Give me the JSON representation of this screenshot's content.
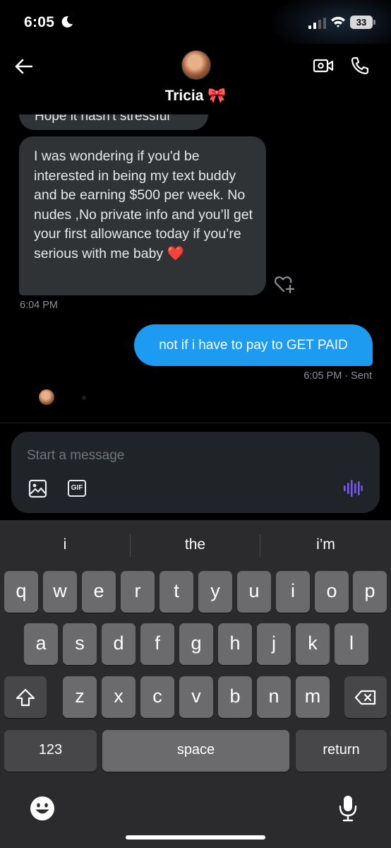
{
  "status_bar": {
    "time": "6:05",
    "battery": "33",
    "icons": [
      "moon-icon",
      "signal-icon",
      "wifi-icon",
      "battery-icon"
    ]
  },
  "header": {
    "contact_name": "Tricia 🎀",
    "icons": [
      "back-arrow-icon",
      "video-call-icon",
      "phone-call-icon"
    ]
  },
  "messages": {
    "partial_text": "Hope it hasn't stressful",
    "incoming": {
      "text": "I was wondering if you'd be interested in being my text buddy and be earning $500 per week. No nudes ,No private info and you’ll get your first allowance today if you’re serious with me baby",
      "emoji": "❤️",
      "time": "6:04 PM"
    },
    "outgoing": {
      "text": "not if i have to pay to GET PAID",
      "time": "6:05 PM",
      "status": "· Sent"
    }
  },
  "composer": {
    "placeholder": "Start a message",
    "gif_label": "GIF"
  },
  "keyboard": {
    "suggestions": [
      "i",
      "the",
      "i’m"
    ],
    "row1": [
      "q",
      "w",
      "e",
      "r",
      "t",
      "y",
      "u",
      "i",
      "o",
      "p"
    ],
    "row2": [
      "a",
      "s",
      "d",
      "f",
      "g",
      "h",
      "j",
      "k",
      "l"
    ],
    "row3": [
      "z",
      "x",
      "c",
      "v",
      "b",
      "n",
      "m"
    ],
    "numbers_label": "123",
    "space_label": "space",
    "return_label": "return"
  },
  "colors": {
    "outgoing_bubble": "#1d9bf0",
    "incoming_bubble": "#2f3336",
    "voice_icon": "#7856ff",
    "keyboard_bg": "#2b2b2d"
  }
}
